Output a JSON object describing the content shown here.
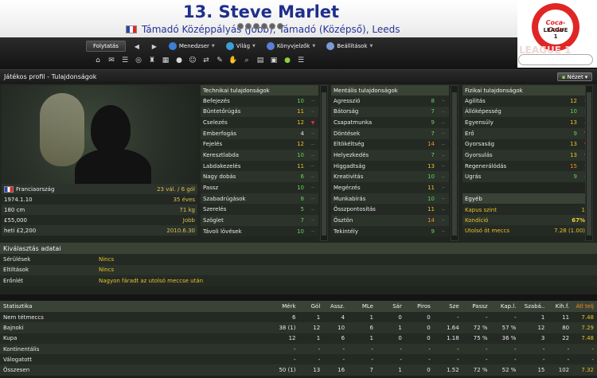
{
  "header": {
    "title": "13. Steve Marlet",
    "subtitle": "Támadó Középpályás (Jobb), Támadó (Középső), Leeds",
    "flag_colors": [
      "#2a46a8",
      "#ffffff",
      "#e22626"
    ],
    "league_logo": {
      "line1": "Coca-Cola",
      "line2": "LEAGUE 1"
    }
  },
  "nav": {
    "continue_label": "Folytatás",
    "back_icon": "back-arrow-icon",
    "forward_icon": "forward-arrow-icon",
    "menus": [
      {
        "label": "Menedzser",
        "icon": "manager-icon",
        "color": "#3c7fd8"
      },
      {
        "label": "Világ",
        "icon": "globe-icon",
        "color": "#3aa0d8"
      },
      {
        "label": "Könyvjelzők",
        "icon": "bookmark-icon",
        "color": "#5a7fd8"
      },
      {
        "label": "Beállítások",
        "icon": "settings-icon",
        "color": "#7d9ad8"
      }
    ],
    "toolbar_icons": [
      "home-icon",
      "inbox-icon",
      "squad-icon",
      "tactics-icon",
      "trophy-icon",
      "calendar-icon",
      "finances-icon",
      "staff-icon",
      "transfer-icon",
      "training-icon",
      "scout-icon",
      "search-icon",
      "notes-icon",
      "clipboard-icon",
      "help-icon",
      "menu-dropdown-icon"
    ]
  },
  "tabbar": {
    "title": "Játékos profil - Tulajdonságok",
    "view_label": "Nézet"
  },
  "info": {
    "rows": [
      {
        "label": "Franciaország",
        "value": "23 vál. / 6 gól"
      },
      {
        "label": "1974.1.10",
        "value": "35 éves"
      },
      {
        "label": "180 cm",
        "value": "71 kg"
      },
      {
        "label": "£55,000",
        "value": "Jobb"
      },
      {
        "label": "heti £2,200",
        "value": "2010.6.30"
      }
    ]
  },
  "attributes": {
    "technical": {
      "title": "Technikai tulajdonságok",
      "rows": [
        {
          "name": "Befejezés",
          "value": "10",
          "color": "g",
          "arrow": "--"
        },
        {
          "name": "Büntetőrúgás",
          "value": "11",
          "color": "y",
          "arrow": "--"
        },
        {
          "name": "Cselezés",
          "value": "12",
          "color": "y",
          "arrow": "▼"
        },
        {
          "name": "Emberfogás",
          "value": "4",
          "color": "w",
          "arrow": "--"
        },
        {
          "name": "Fejelés",
          "value": "12",
          "color": "y",
          "arrow": "--"
        },
        {
          "name": "Keresztlabda",
          "value": "10",
          "color": "g",
          "arrow": "--"
        },
        {
          "name": "Labdakezelés",
          "value": "11",
          "color": "y",
          "arrow": "--"
        },
        {
          "name": "Nagy dobás",
          "value": "6",
          "color": "g",
          "arrow": "--"
        },
        {
          "name": "Passz",
          "value": "10",
          "color": "g",
          "arrow": "--"
        },
        {
          "name": "Szabadrúgások",
          "value": "8",
          "color": "g",
          "arrow": "--"
        },
        {
          "name": "Szerelés",
          "value": "5",
          "color": "g",
          "arrow": "--"
        },
        {
          "name": "Szöglet",
          "value": "7",
          "color": "g",
          "arrow": "--"
        },
        {
          "name": "Távoli lövések",
          "value": "10",
          "color": "g",
          "arrow": "--"
        }
      ]
    },
    "mental": {
      "title": "Mentális tulajdonságok",
      "rows": [
        {
          "name": "Agresszió",
          "value": "8",
          "color": "g",
          "arrow": "--"
        },
        {
          "name": "Bátorság",
          "value": "7",
          "color": "g",
          "arrow": "--"
        },
        {
          "name": "Csapatmunka",
          "value": "9",
          "color": "g",
          "arrow": "--"
        },
        {
          "name": "Döntések",
          "value": "7",
          "color": "g",
          "arrow": "--"
        },
        {
          "name": "Eltökéltség",
          "value": "14",
          "color": "o",
          "arrow": "--"
        },
        {
          "name": "Helyezkedés",
          "value": "7",
          "color": "g",
          "arrow": "--"
        },
        {
          "name": "Higgadtság",
          "value": "13",
          "color": "y",
          "arrow": "--"
        },
        {
          "name": "Kreativitás",
          "value": "10",
          "color": "g",
          "arrow": "--"
        },
        {
          "name": "Megérzés",
          "value": "11",
          "color": "y",
          "arrow": "--"
        },
        {
          "name": "Munkabírás",
          "value": "10",
          "color": "g",
          "arrow": "--"
        },
        {
          "name": "Összpontosítás",
          "value": "11",
          "color": "y",
          "arrow": "--"
        },
        {
          "name": "Ösztön",
          "value": "14",
          "color": "o",
          "arrow": "--"
        },
        {
          "name": "Tekintély",
          "value": "9",
          "color": "g",
          "arrow": "--"
        }
      ]
    },
    "physical": {
      "title": "Fizikai tulajdonságok",
      "rows": [
        {
          "name": "Agilitás",
          "value": "12",
          "color": "y",
          "arrow": "--"
        },
        {
          "name": "Állóképesség",
          "value": "10",
          "color": "g",
          "arrow": "--"
        },
        {
          "name": "Egyensúly",
          "value": "13",
          "color": "y",
          "arrow": "--"
        },
        {
          "name": "Erő",
          "value": "9",
          "color": "g",
          "arrow": "▼"
        },
        {
          "name": "Gyorsaság",
          "value": "13",
          "color": "y",
          "arrow": "▼"
        },
        {
          "name": "Gyorsulás",
          "value": "13",
          "color": "y",
          "arrow": "▼"
        },
        {
          "name": "Regenerálódás",
          "value": "15",
          "color": "o",
          "arrow": "--"
        },
        {
          "name": "Ugrás",
          "value": "9",
          "color": "g",
          "arrow": "--"
        }
      ]
    },
    "other": {
      "title": "Egyéb",
      "rows": [
        {
          "name": "Kapus szint",
          "value": "1"
        },
        {
          "name": "Kondíció",
          "value": "67%"
        },
        {
          "name": "Utolsó öt meccs",
          "value": "7.28 (1.00)"
        }
      ]
    }
  },
  "selection": {
    "title": "Kiválasztás adatai",
    "rows": [
      {
        "label": "Sérülések",
        "value": "Nincs"
      },
      {
        "label": "Eltiltások",
        "value": "Nincs"
      },
      {
        "label": "Erőnlét",
        "value": "Nagyon fáradt az utolsó meccse után"
      }
    ]
  },
  "stats": {
    "headers": [
      "Statisztika",
      "Mérk",
      "Gól",
      "Assz.",
      "MLe",
      "Sár",
      "Piros",
      "Sze",
      "Passz",
      "Kap.l.",
      "Szabá..",
      "Kih.f.",
      "Átl telj"
    ],
    "rows": [
      [
        "Nem tétmeccs",
        "6",
        "1",
        "4",
        "1",
        "0",
        "0",
        "-",
        "-",
        "-",
        "1",
        "11",
        "7.48"
      ],
      [
        "Bajnoki",
        "38 (1)",
        "12",
        "10",
        "6",
        "1",
        "0",
        "1.64",
        "72 %",
        "57 %",
        "12",
        "80",
        "7.29"
      ],
      [
        "Kupa",
        "12",
        "1",
        "6",
        "1",
        "0",
        "0",
        "1.18",
        "75 %",
        "36 %",
        "3",
        "22",
        "7.48"
      ],
      [
        "Kontinentális",
        "-",
        "-",
        "-",
        "-",
        "-",
        "-",
        "-",
        "-",
        "-",
        "-",
        "-",
        "-"
      ],
      [
        "Válogatott",
        "-",
        "-",
        "-",
        "-",
        "-",
        "-",
        "-",
        "-",
        "-",
        "-",
        "-",
        "-"
      ],
      [
        "Összesen",
        "50 (1)",
        "13",
        "16",
        "7",
        "1",
        "0",
        "1.52",
        "72 %",
        "52 %",
        "15",
        "102",
        "7.32"
      ]
    ]
  }
}
